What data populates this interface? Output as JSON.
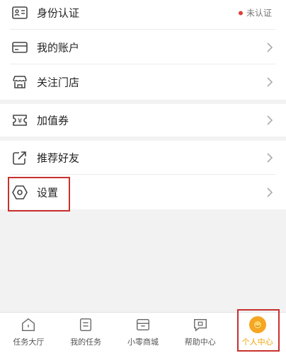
{
  "menu": {
    "identity": {
      "label": "身份认证",
      "status": "未认证",
      "icon": "id-card-icon"
    },
    "account": {
      "label": "我的账户",
      "icon": "card-icon"
    },
    "stores": {
      "label": "关注门店",
      "icon": "store-icon"
    },
    "coupons": {
      "label": "加值券",
      "icon": "yen-coupon-icon"
    },
    "invite": {
      "label": "推荐好友",
      "icon": "share-icon"
    },
    "settings": {
      "label": "设置",
      "icon": "hexagon-settings-icon"
    }
  },
  "bottom_nav": [
    {
      "label": "任务大厅",
      "icon": "home-icon"
    },
    {
      "label": "我的任务",
      "icon": "task-list-icon"
    },
    {
      "label": "小零商城",
      "icon": "shop-icon"
    },
    {
      "label": "帮助中心",
      "icon": "chat-help-icon"
    },
    {
      "label": "个人中心",
      "icon": "avatar-icon",
      "active": true
    }
  ],
  "colors": {
    "accent": "#f2a100",
    "highlight": "#c8302d",
    "status_dot": "#d9413a"
  }
}
